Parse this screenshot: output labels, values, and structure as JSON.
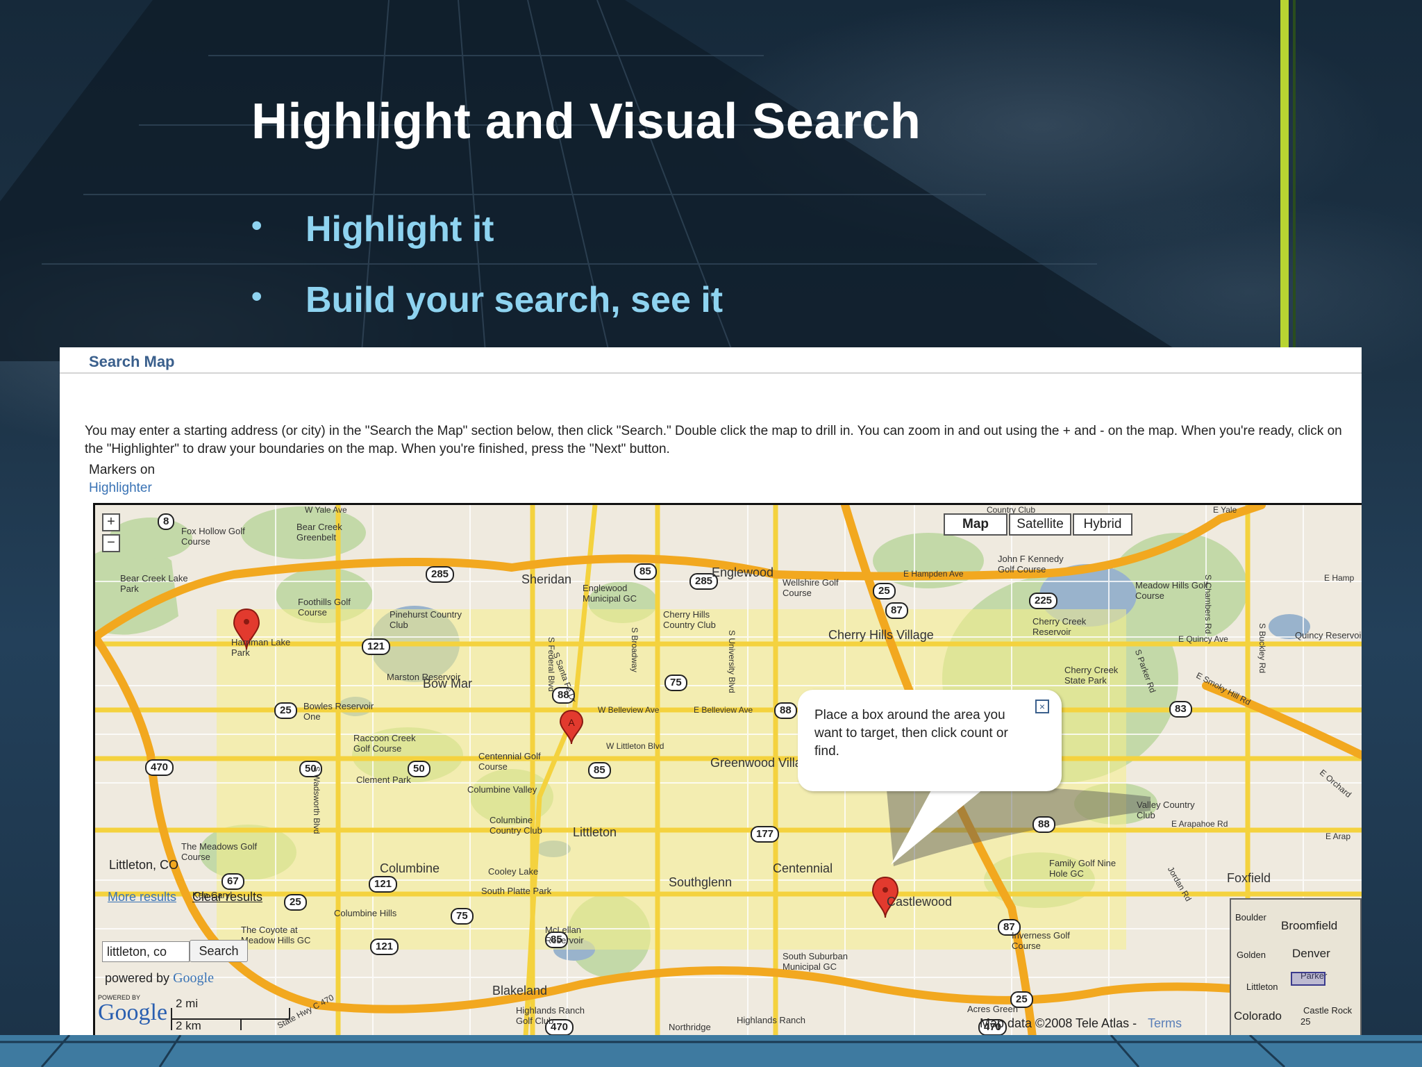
{
  "slide": {
    "title": "Highlight and Visual Search",
    "bullets": [
      "Highlight it",
      "Build your search, see it"
    ]
  },
  "panel": {
    "title": "Search Map",
    "instructions": "You may enter a starting address (or city) in the \"Search the Map\" section below, then click \"Search.\" Double click the map to drill in. You can zoom in and out using the + and - on the map. When you're ready, click on the \"Highlighter\" to draw your boundaries on the map. When you're finished, press the \"Next\" button.",
    "markers_label": "Markers on",
    "highlighter_link": "Highlighter"
  },
  "map": {
    "zoom_in": "+",
    "zoom_out": "−",
    "map_types": [
      "Map",
      "Satellite",
      "Hybrid"
    ],
    "active_map_type": "Map",
    "callout_text": "Place a box around the area you want to target, then click count or find.",
    "callout_close": "×",
    "result_label": "Littleton, CO",
    "more_results": "More results",
    "clear_results": "Clear results",
    "search_value": "littleton, co",
    "search_button": "Search",
    "powered_by": "powered by",
    "powered_by_brand": "Google",
    "logo_small": "POWERED BY",
    "logo": "Google",
    "scale_mi": "2 mi",
    "scale_km": "2 km",
    "copyright": "Map data ©2008 Tele Atlas -",
    "terms": "Terms",
    "marker_a": "A",
    "places": [
      "Fox Hollow Golf Course",
      "Bear Creek Greenbelt",
      "Bear Creek Lake Park",
      "Harriman Lake Park",
      "Foothills Golf Course",
      "Pinehurst Country Club",
      "Sheridan",
      "Englewood Municipal GC",
      "Englewood",
      "Cherry Hills Country Club",
      "Wellshire Golf Course",
      "John F Kennedy Golf Course",
      "Cherry Hills Village",
      "Cherry Creek Reservoir",
      "Cherry Creek State Park",
      "Meadow Hills Golf Course",
      "Marston Reservoir",
      "Bow Mar",
      "Bowles Reservoir One",
      "Raccoon Creek Golf Course",
      "Centennial Golf Course",
      "Greenwood Village",
      "Clement Park",
      "Columbine Valley",
      "Columbine Country Club",
      "Littleton",
      "The Meadows Golf Course",
      "Columbine",
      "Cooley Lake",
      "South Platte Park",
      "Southglenn",
      "Centennial",
      "Castlewood",
      "Family Golf Nine Hole GC",
      "Valley Country Club",
      "Foxfield",
      "Columbine Hills",
      "The Coyote at Meadow Hills GC",
      "McLellan Reservoir",
      "Blakeland",
      "Highlands Ranch Golf Club",
      "Northridge",
      "Highlands Ranch",
      "South Suburban Municipal GC",
      "Inverness Golf Course",
      "Acres Green",
      "Quincy Reservoir",
      "Ken Caryl"
    ],
    "roads": [
      "E Hampden Ave",
      "E Quincy Ave",
      "E Smoky Hill Rd",
      "W Belleview Ave",
      "E Belleview Ave",
      "W Littleton Blvd",
      "E Arapahoe Rd",
      "State Hwy C 470",
      "S Federal Blvd",
      "S Santa Fe Dr",
      "S Broadway",
      "S University Blvd",
      "S Wadsworth Blvd",
      "S Parker Rd",
      "S Chambers Rd",
      "S Buckley Rd",
      "Jordan Rd",
      "W Yale Ave",
      "Country Club",
      "E Yale",
      "E Hamp",
      "E Orchard",
      "E Arap"
    ],
    "shields": [
      "8",
      "285",
      "85",
      "285",
      "121",
      "25",
      "88",
      "75",
      "88",
      "470",
      "50",
      "50",
      "85",
      "177",
      "67",
      "121",
      "25",
      "75",
      "85",
      "121",
      "470",
      "470",
      "87",
      "225",
      "25",
      "83",
      "88",
      "87",
      "25"
    ],
    "mini_map": [
      "Boulder",
      "Broomfield",
      "Golden",
      "Denver",
      "Parker",
      "Littleton",
      "Castle Rock",
      "Colorado",
      "25"
    ]
  }
}
